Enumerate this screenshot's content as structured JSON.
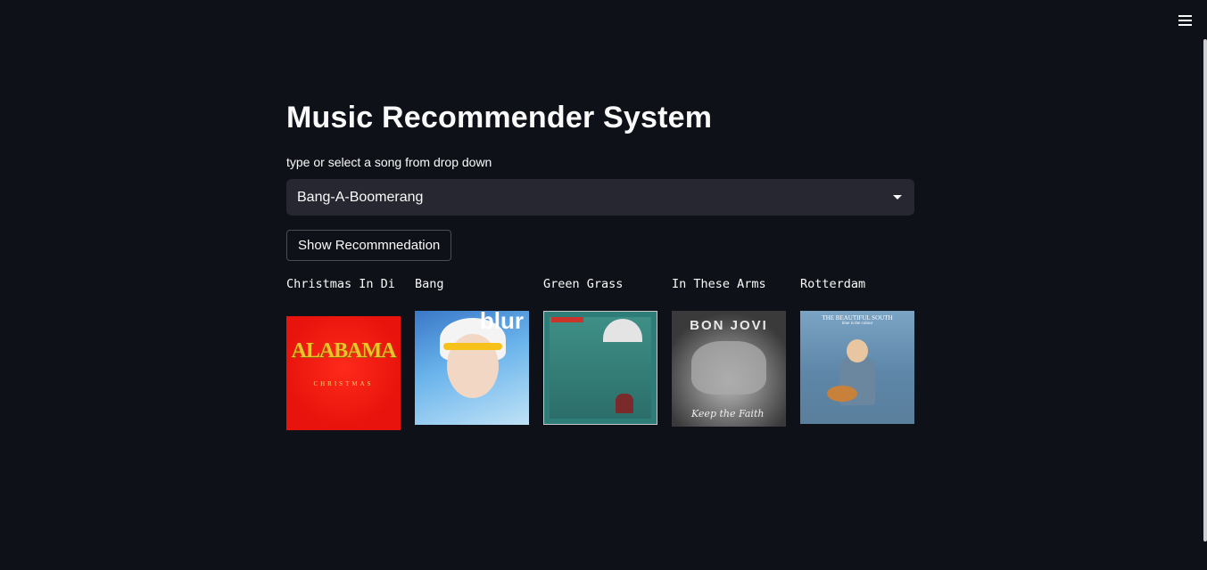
{
  "header": {
    "menu_icon": "hamburger-menu-icon"
  },
  "main": {
    "title": "Music Recommender System",
    "select": {
      "label": "type or select a song from drop down",
      "value": "Bang-A-Boomerang"
    },
    "button_label": "Show Recommnedation"
  },
  "recommendations": [
    {
      "title": "Christmas In Di",
      "cover_text": "ALABAMA",
      "cover_subtext": "CHRISTMAS"
    },
    {
      "title": "Bang",
      "cover_text": "blur"
    },
    {
      "title": "Green Grass"
    },
    {
      "title": "In These Arms",
      "cover_text": "BON JOVI",
      "cover_subtext": "Keep the Faith"
    },
    {
      "title": "Rotterdam",
      "cover_text": "THE BEAUTIFUL SOUTH",
      "cover_subtext": "blue is the colour"
    }
  ]
}
